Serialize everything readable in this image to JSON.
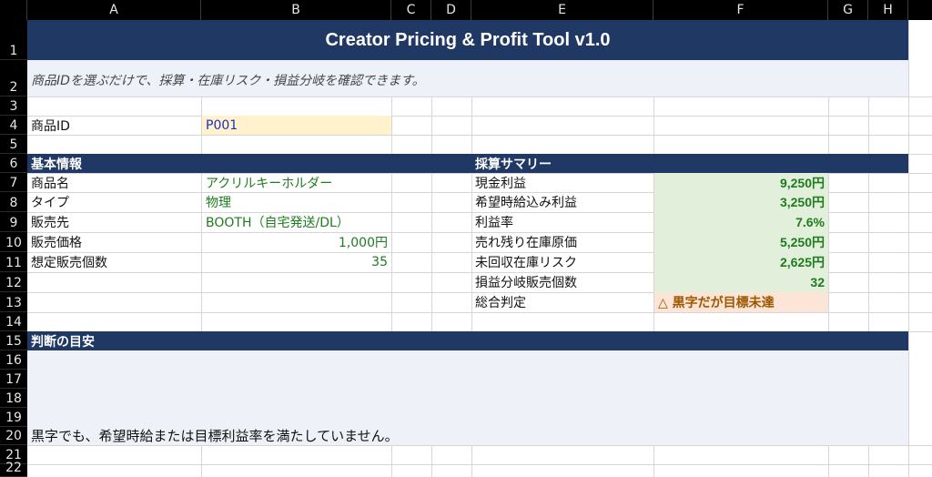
{
  "columns": [
    "A",
    "B",
    "C",
    "D",
    "E",
    "F",
    "G",
    "H"
  ],
  "rows": [
    "1",
    "2",
    "3",
    "4",
    "5",
    "6",
    "7",
    "8",
    "9",
    "10",
    "11",
    "12",
    "13",
    "14",
    "15",
    "16",
    "17",
    "18",
    "19",
    "20",
    "21",
    "22"
  ],
  "title": "Creator Pricing & Profit Tool v1.0",
  "subtitle": "商品IDを選ぶだけで、採算・在庫リスク・損益分岐を確認できます。",
  "product_id": {
    "label": "商品ID",
    "value": "P001"
  },
  "basic_info": {
    "header": "基本情報",
    "items": [
      {
        "label": "商品名",
        "value": "アクリルキーホルダー"
      },
      {
        "label": "タイプ",
        "value": "物理"
      },
      {
        "label": "販売先",
        "value": "BOOTH（自宅発送/DL）"
      },
      {
        "label": "販売価格",
        "value": "1,000円"
      },
      {
        "label": "想定販売個数",
        "value": "35"
      }
    ]
  },
  "summary": {
    "header": "採算サマリー",
    "items": [
      {
        "label": "現金利益",
        "value": "9,250円"
      },
      {
        "label": "希望時給込み利益",
        "value": "3,250円"
      },
      {
        "label": "利益率",
        "value": "7.6%"
      },
      {
        "label": "売れ残り在庫原価",
        "value": "5,250円"
      },
      {
        "label": "未回収在庫リスク",
        "value": "2,625円"
      },
      {
        "label": "損益分岐販売個数",
        "value": "32"
      },
      {
        "label": "総合判定",
        "value": "△ 黒字だが目標未達"
      }
    ]
  },
  "guidance": {
    "header": "判断の目安",
    "text": "黒字でも、希望時給または目標利益率を満たしていません。"
  },
  "colors": {
    "header_bg": "#1f3864",
    "kpi_bg": "#e2efda",
    "warn_bg": "#fce4d6",
    "input_bg": "#fff2cc"
  }
}
